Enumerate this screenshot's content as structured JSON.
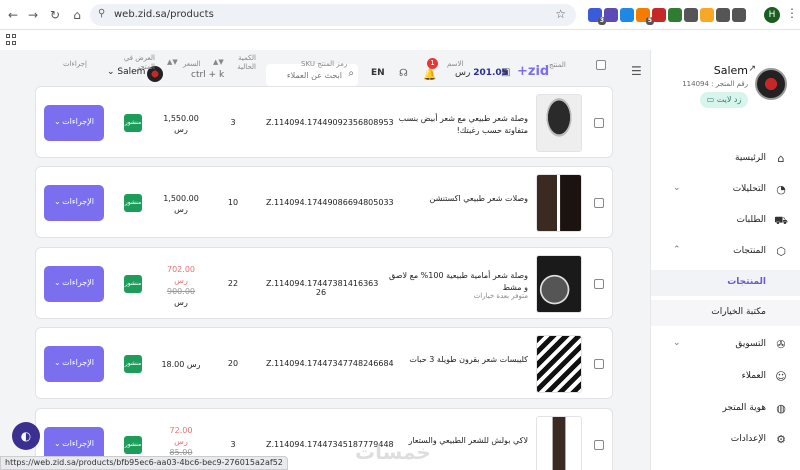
{
  "browser": {
    "url": "web.zid.sa/products",
    "status_url": "https://web.zid.sa/products/bfb95ec6-aa03-4bc6-bec9-276015a2af52",
    "profile_initial": "H",
    "extensions": [
      {
        "icon": "extension-blue-icon",
        "color": "#3b5bdb",
        "badge": "3"
      },
      {
        "icon": "extension-purple-icon",
        "color": "#5c4bb5",
        "badge": ""
      },
      {
        "icon": "extension-m-icon",
        "color": "#1e88e5",
        "badge": ""
      },
      {
        "icon": "extension-orange-icon",
        "color": "#f57c00",
        "badge": "5"
      },
      {
        "icon": "extension-star-icon",
        "color": "#c62828",
        "badge": ""
      },
      {
        "icon": "extension-image-icon",
        "color": "#2e7d32",
        "badge": ""
      },
      {
        "icon": "extension-camera-icon",
        "color": "#555555",
        "badge": ""
      },
      {
        "icon": "extension-amazon-icon",
        "color": "#f9a825",
        "badge": ""
      },
      {
        "icon": "extension-clipboard-icon",
        "color": "#555555",
        "badge": ""
      },
      {
        "icon": "extension-puzzle-icon",
        "color": "#555555",
        "badge": ""
      }
    ]
  },
  "sidebar": {
    "store_name": "Salem",
    "store_number": "رقم المتجر : 114094",
    "upgrade_label": "زد لايت",
    "items": [
      {
        "label": "الرئيسية",
        "icon": "home-icon",
        "glyph": "⌂",
        "chevron": "",
        "active": false
      },
      {
        "label": "التحليلات",
        "icon": "analytics-icon",
        "glyph": "◔",
        "chevron": "⌄",
        "active": false
      },
      {
        "label": "الطلبات",
        "icon": "cart-icon",
        "glyph": "⛟",
        "chevron": "",
        "active": false
      },
      {
        "label": "المنتجات",
        "icon": "box-icon",
        "glyph": "⬡",
        "chevron": "⌃",
        "active": false
      },
      {
        "label": "المنتجات",
        "icon": "",
        "glyph": "",
        "chevron": "",
        "active": true
      },
      {
        "label": "مكتبة الخيارات",
        "icon": "",
        "glyph": "",
        "chevron": "",
        "active": false
      },
      {
        "label": "التسويق",
        "icon": "megaphone-icon",
        "glyph": "✇",
        "chevron": "⌄",
        "active": false
      },
      {
        "label": "العملاء",
        "icon": "customers-icon",
        "glyph": "☺",
        "chevron": "",
        "active": false
      },
      {
        "label": "هوية المتجر",
        "icon": "palette-icon",
        "glyph": "◍",
        "chevron": "",
        "active": false
      },
      {
        "label": "الإعدادات",
        "icon": "settings-icon",
        "glyph": "⚙",
        "chevron": "",
        "active": false
      }
    ]
  },
  "topbar": {
    "logo": "+zid",
    "balance_value": "201.05",
    "balance_currency": "رس",
    "notification_count": "1",
    "language": "EN",
    "search_placeholder": "ابحث عن العملاء",
    "shortcut": "ctrl + k",
    "user_name": "Salem"
  },
  "columns": {
    "product": "المنتج",
    "name": "الاسم",
    "sku": "رمز المنتج SKU",
    "qty": "الكمية الحالية",
    "price": "السعر",
    "show": "العرض في المتجر",
    "actions": "إجراءات"
  },
  "products": [
    {
      "name": "وصلة شعر طبيعي مع شعر أبيض بنسب متفاوتة حسب رغبتك!",
      "subtitle": "",
      "sku": "Z.114094.17449092356808953",
      "qty": "3",
      "price": "1,550.00",
      "old_price": "",
      "currency": "رس",
      "status": "منشور",
      "action_label": "الإجراءات",
      "thumb": "grey-hair"
    },
    {
      "name": "وصلات شعر طبيعي اكستنشن",
      "subtitle": "",
      "sku": "Z.114094.17449086694805033",
      "qty": "10",
      "price": "1,500.00",
      "old_price": "",
      "currency": "رس",
      "status": "منشور",
      "action_label": "الإجراءات",
      "thumb": "extensions"
    },
    {
      "name": "وصلة شعر أمامية طبيعية 100% مع لاصق و مشط",
      "subtitle": "متوفر بعدة خيارات",
      "sku": "Z.114094.17447381416363 26",
      "qty": "22",
      "price": "702.00",
      "old_price": "900.00",
      "currency": "رس",
      "status": "منشور",
      "action_label": "الإجراءات",
      "thumb": "front-piece"
    },
    {
      "name": "كليبسات شعر بقرون طويلة 3 حبات",
      "subtitle": "",
      "sku": "Z.114094.17447347748246684",
      "qty": "20",
      "price": "18.00",
      "old_price": "",
      "currency": "رس",
      "status": "منشور",
      "action_label": "الإجراءات",
      "thumb": "clips"
    },
    {
      "name": "لاكي بولش للشعر الطبيعي والستعار",
      "subtitle": "",
      "sku": "Z.114094.17447345187779448",
      "qty": "3",
      "price": "72.00",
      "old_price": "85.00",
      "currency": "رس",
      "status": "منشور",
      "action_label": "الإجراءات",
      "thumb": "spray"
    }
  ],
  "watermark": "خمسات"
}
